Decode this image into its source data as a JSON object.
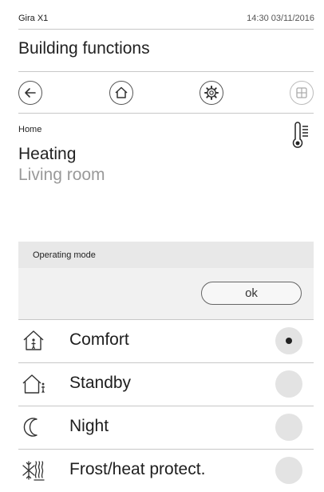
{
  "status": {
    "app_name": "Gira X1",
    "time_date": "14:30  03/11/2016"
  },
  "header": {
    "title": "Building functions"
  },
  "nav": {
    "back_icon": "arrow-left-icon",
    "home_icon": "home-icon",
    "settings_icon": "gear-icon",
    "grid_icon": "grid-icon"
  },
  "function": {
    "breadcrumb": "Home",
    "title": "Heating",
    "subtitle": "Living room",
    "icon": "thermometer-icon"
  },
  "dialog": {
    "header": "Operating mode",
    "ok_label": "ok",
    "modes": [
      {
        "label": "Comfort",
        "icon": "house-comfort-icon",
        "selected": true
      },
      {
        "label": "Standby",
        "icon": "house-standby-icon",
        "selected": false
      },
      {
        "label": "Night",
        "icon": "moon-icon",
        "selected": false
      },
      {
        "label": "Frost/heat protect.",
        "icon": "frost-heat-icon",
        "selected": false
      }
    ]
  },
  "colors": {
    "accent_text": "#9a9a9a",
    "panel_header": "#e8e8e8",
    "radio_fill": "#e3e3e3"
  }
}
